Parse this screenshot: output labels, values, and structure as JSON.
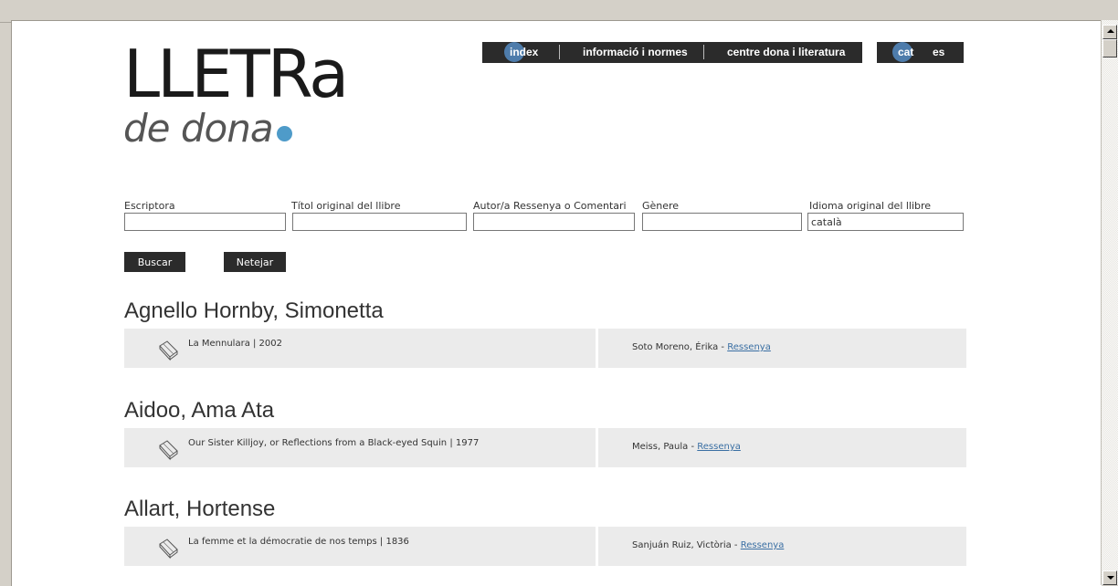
{
  "logo": {
    "main": "LLETRa",
    "sub": "de dona"
  },
  "nav": {
    "items": [
      "index",
      "informació i normes",
      "centre dona i literatura"
    ]
  },
  "lang": {
    "items": [
      "cat",
      "es"
    ]
  },
  "filters": {
    "labels": [
      "Escriptora",
      "Títol original del llibre",
      "Autor/a Ressenya o Comentari",
      "Gènere",
      "Idioma original del llibre"
    ],
    "values": [
      "",
      "",
      "",
      "",
      "català"
    ]
  },
  "buttons": {
    "search": "Buscar",
    "clear": "Netejar"
  },
  "results": [
    {
      "author": "Agnello Hornby, Simonetta",
      "book": "La Mennulara | 2002",
      "reviewer": "Soto Moreno, Érika - ",
      "link": "Ressenya"
    },
    {
      "author": "Aidoo, Ama Ata",
      "book": "Our Sister Killjoy, or Reflections from a Black-eyed Squin | 1977",
      "reviewer": "Meiss, Paula - ",
      "link": "Ressenya"
    },
    {
      "author": "Allart, Hortense",
      "book": "La femme et la démocratie de nos temps | 1836",
      "reviewer": "Sanjuán Ruiz, Victòria - ",
      "link": "Ressenya"
    }
  ],
  "colors": {
    "accent": "#4e9bc9",
    "nav_bg": "#2b2b2b",
    "row_bg": "#ebebeb",
    "link": "#3a6fa3"
  }
}
